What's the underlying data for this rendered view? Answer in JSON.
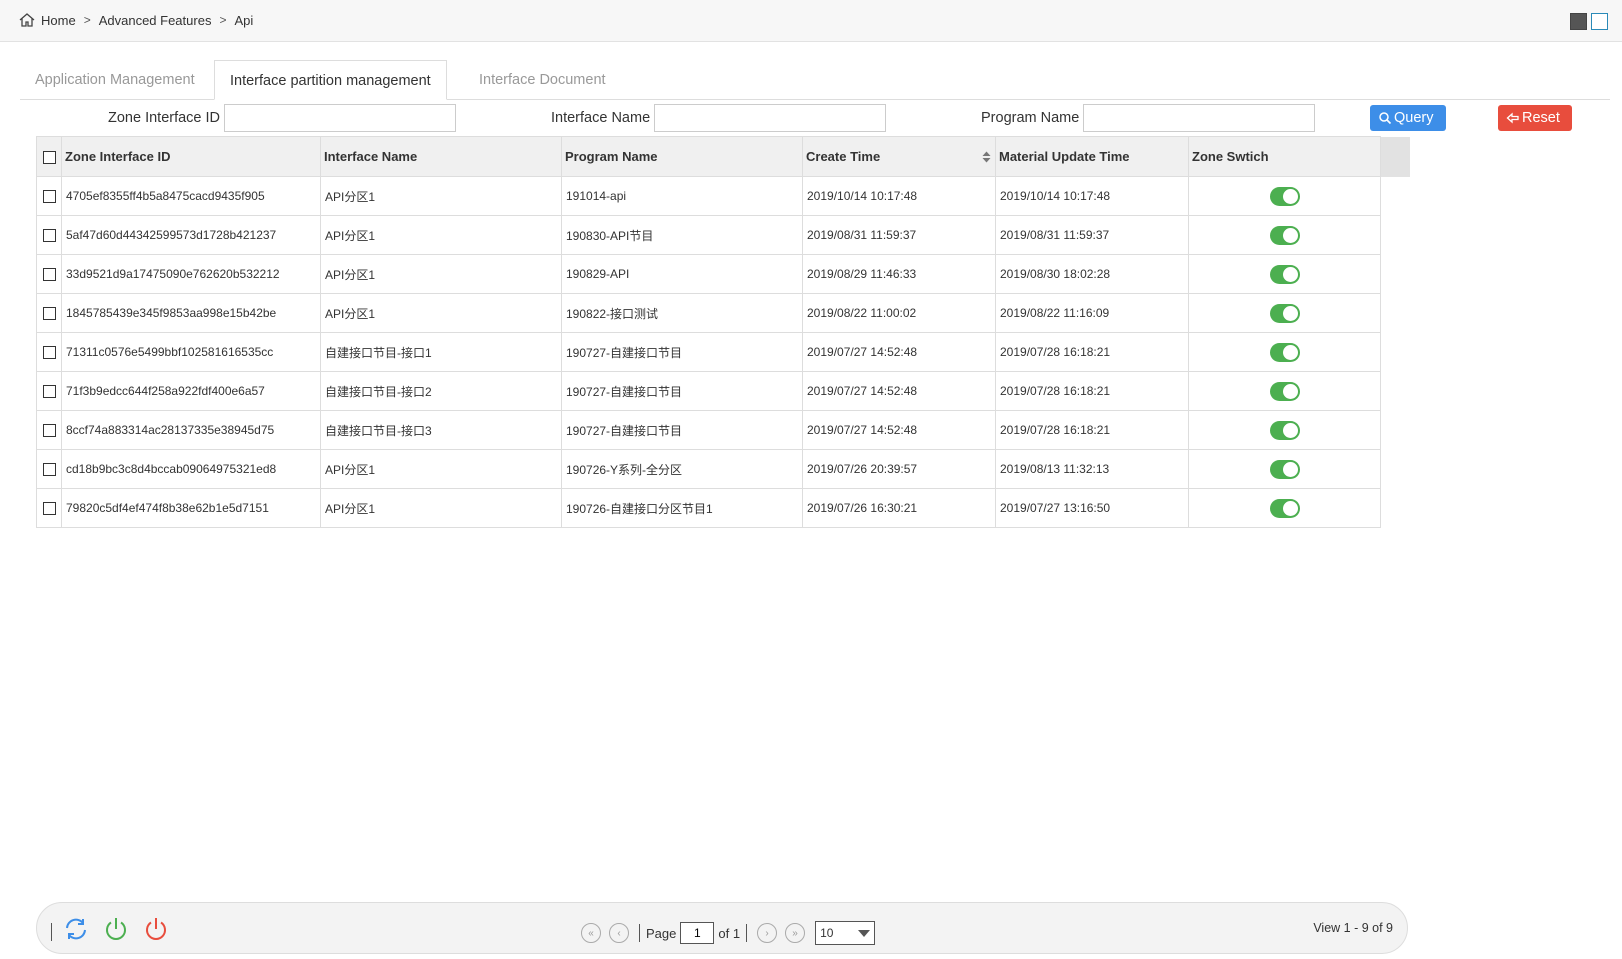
{
  "breadcrumb": {
    "home": "Home",
    "level1": "Advanced Features",
    "level2": "Api",
    "sep": ">"
  },
  "tabs": [
    {
      "label": "Application Management"
    },
    {
      "label": "Interface partition management"
    },
    {
      "label": "Interface Document"
    }
  ],
  "filters": {
    "zone_id_label": "Zone Interface ID",
    "iface_name_label": "Interface Name",
    "program_name_label": "Program Name",
    "zone_id_value": "",
    "iface_name_value": "",
    "program_name_value": ""
  },
  "buttons": {
    "query": "Query",
    "reset": "Reset"
  },
  "table": {
    "headers": [
      "Zone Interface ID",
      "Interface Name",
      "Program Name",
      "Create Time",
      "Material Update Time",
      "Zone Swtich"
    ],
    "rows": [
      {
        "id": "4705ef8355ff4b5a8475cacd9435f905",
        "iface": "API分区1",
        "program": "191014-api",
        "create": "2019/10/14 10:17:48",
        "update": "2019/10/14 10:17:48",
        "switch_on": true
      },
      {
        "id": "5af47d60d44342599573d1728b421237",
        "iface": "API分区1",
        "program": "190830-API节目",
        "create": "2019/08/31 11:59:37",
        "update": "2019/08/31 11:59:37",
        "switch_on": true
      },
      {
        "id": "33d9521d9a17475090e762620b532212",
        "iface": "API分区1",
        "program": "190829-API",
        "create": "2019/08/29 11:46:33",
        "update": "2019/08/30 18:02:28",
        "switch_on": true
      },
      {
        "id": "1845785439e345f9853aa998e15b42be",
        "iface": "API分区1",
        "program": "190822-接口测试",
        "create": "2019/08/22 11:00:02",
        "update": "2019/08/22 11:16:09",
        "switch_on": true
      },
      {
        "id": "71311c0576e5499bbf102581616535cc",
        "iface": "自建接口节目-接口1",
        "program": "190727-自建接口节目",
        "create": "2019/07/27 14:52:48",
        "update": "2019/07/28 16:18:21",
        "switch_on": true
      },
      {
        "id": "71f3b9edcc644f258a922fdf400e6a57",
        "iface": "自建接口节目-接口2",
        "program": "190727-自建接口节目",
        "create": "2019/07/27 14:52:48",
        "update": "2019/07/28 16:18:21",
        "switch_on": true
      },
      {
        "id": "8ccf74a883314ac28137335e38945d75",
        "iface": "自建接口节目-接口3",
        "program": "190727-自建接口节目",
        "create": "2019/07/27 14:52:48",
        "update": "2019/07/28 16:18:21",
        "switch_on": true
      },
      {
        "id": "cd18b9bc3c8d4bccab09064975321ed8",
        "iface": "API分区1",
        "program": "190726-Y系列-全分区",
        "create": "2019/07/26 20:39:57",
        "update": "2019/08/13 11:32:13",
        "switch_on": true
      },
      {
        "id": "79820c5df4ef474f8b38e62b1e5d7151",
        "iface": "API分区1",
        "program": "190726-自建接口分区节目1",
        "create": "2019/07/26 16:30:21",
        "update": "2019/07/27 13:16:50",
        "switch_on": true
      }
    ]
  },
  "pager": {
    "page_label": "Page",
    "page_value": "1",
    "of_label": "of 1",
    "page_size": "10",
    "view_text": "View 1 - 9 of 9"
  },
  "colors": {
    "query": "#3d8ee8",
    "reset": "#e84d3d",
    "switch_on": "#4caf50",
    "refresh": "#3d8ee8",
    "enable": "#4caf50",
    "disable": "#e84d3d"
  }
}
